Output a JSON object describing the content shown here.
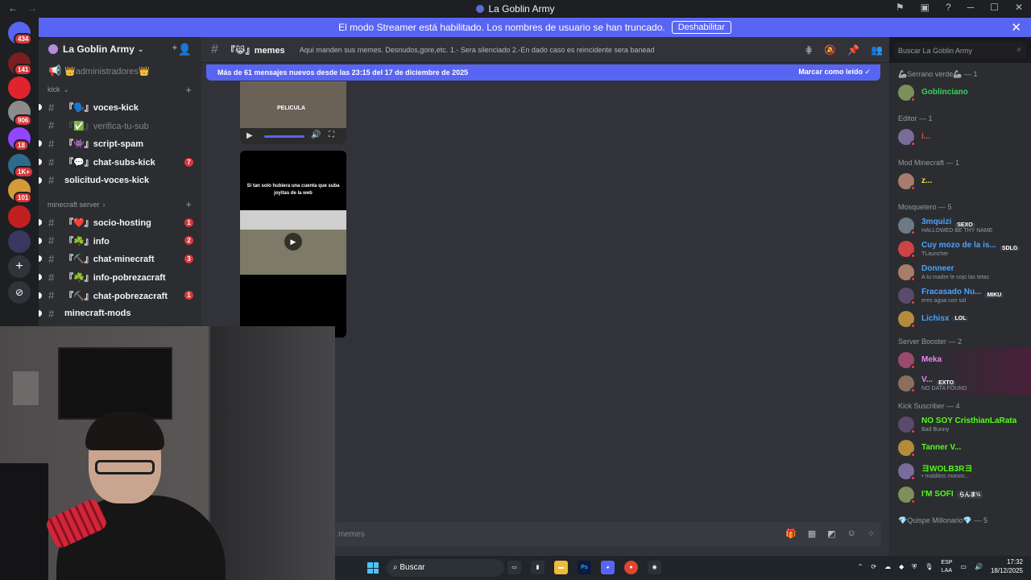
{
  "window": {
    "title": "La Goblin Army"
  },
  "banner": {
    "text": "El modo Streamer está habilitado. Los nombres de usuario se han truncado.",
    "button": "Deshabilitar"
  },
  "guilds": [
    {
      "badge": "434"
    },
    {
      "badge": "141"
    },
    {
      "badge": ""
    },
    {
      "badge": "906"
    },
    {
      "badge": "18"
    },
    {
      "badge": "1K+"
    },
    {
      "badge": "101"
    },
    {
      "badge": ""
    },
    {
      "badge": ""
    }
  ],
  "server": {
    "name": "La Goblin Army"
  },
  "channels_top": {
    "admin": "👑administradores👑"
  },
  "categories": {
    "kick": "kick",
    "minecraft": "minecraft server"
  },
  "channels": [
    {
      "name": "『🗣️』voces-kick",
      "badge": "",
      "unread": true,
      "muted": false
    },
    {
      "name": "『✅』verifica-tu-sub",
      "badge": "",
      "unread": false,
      "muted": true
    },
    {
      "name": "『👾』script-spam",
      "badge": "",
      "unread": true,
      "muted": false
    },
    {
      "name": "『💬』chat-subs-kick",
      "badge": "7",
      "unread": true,
      "muted": false
    },
    {
      "name": "solicitud-voces-kick",
      "badge": "",
      "unread": true,
      "muted": false
    },
    {
      "name": "『❤️』socio-hosting",
      "badge": "1",
      "unread": true,
      "muted": false
    },
    {
      "name": "『☘️』info",
      "badge": "2",
      "unread": true,
      "muted": false
    },
    {
      "name": "『⛏️』chat-minecraft",
      "badge": "3",
      "unread": true,
      "muted": false
    },
    {
      "name": "『☘️』info-pobrezacraft",
      "badge": "",
      "unread": true,
      "muted": false
    },
    {
      "name": "『⛏️』chat-pobrezacraft",
      "badge": "1",
      "unread": true,
      "muted": false
    },
    {
      "name": "minecraft-mods",
      "badge": "",
      "unread": true,
      "muted": false
    }
  ],
  "chat": {
    "channel": "『😹』memes",
    "topic": "Aqui manden sus memes. Desnudos,gore,etc. 1.- Sera silenciado 2.-En dado caso es reincidente sera baneado",
    "new_messages": "Más de 61 mensajes nuevos desde las 23:15 del 17 de diciembre de 2025",
    "mark_read": "Marcar como leído",
    "media1_label": "PELICULA",
    "media2_caption": "Si tan solo hubiera una cuenta que suba joyitas de la web",
    "composer_placeholder": "memes"
  },
  "search": {
    "placeholder": "Buscar La Goblin Army"
  },
  "members": {
    "roles": [
      {
        "label": "🦾Serrano verde🦾 — 1"
      },
      {
        "label": "Editor — 1"
      },
      {
        "label": "Mod Minecraft — 1"
      },
      {
        "label": "Mosquetero — 5"
      },
      {
        "label": "Server Booster — 2"
      },
      {
        "label": "Kick Suscriber — 4"
      },
      {
        "label": "💎Quispe Millonario💎 — 5"
      }
    ],
    "serrano": [
      {
        "name": "Goblinciano",
        "color": "#3ad25c",
        "tag": "",
        "sub": ""
      }
    ],
    "editor": [
      {
        "name": "i...",
        "color": "#e8505b",
        "tag": "",
        "sub": ""
      }
    ],
    "mod": [
      {
        "name": "z...",
        "color": "#f0e04a",
        "tag": "",
        "sub": ""
      }
    ],
    "mosquetero": [
      {
        "name": "3mquizi",
        "color": "#4aa3ff",
        "tag": "SEXO",
        "sub": "HALLOWED BE THY NAME"
      },
      {
        "name": "Cuy mozo de la is...",
        "color": "#4aa3ff",
        "tag": "SDLG",
        "sub": "TLauncher"
      },
      {
        "name": "Donneer",
        "color": "#4aa3ff",
        "tag": "",
        "sub": "A tu madre le cojo las tetas"
      },
      {
        "name": "Fracasado Nu...",
        "color": "#4aa3ff",
        "tag": "MIKU",
        "sub": "eres agua con sal"
      },
      {
        "name": "Lichisx",
        "color": "#4aa3ff",
        "tag": "LOL",
        "sub": ""
      }
    ],
    "boosters": [
      {
        "name": "Meka",
        "color": "#f47fff",
        "tag": "",
        "sub": ""
      },
      {
        "name": "V...",
        "color": "#f47fff",
        "tag": "EXTO",
        "sub": "NO DATA FOUND"
      }
    ],
    "kick": [
      {
        "name": "NO SOY CristhianLaRata",
        "color": "#53fc18",
        "tag": "",
        "sub": "Bad Bunny"
      },
      {
        "name": "Tanner V...",
        "color": "#53fc18",
        "tag": "",
        "sub": ""
      },
      {
        "name": "ヨWOLB3Rヨ",
        "color": "#53fc18",
        "tag": "",
        "sub": "• malditos monos..."
      },
      {
        "name": "I'M SOFI",
        "color": "#53fc18",
        "tag": "らんま½",
        "sub": ""
      }
    ]
  },
  "taskbar": {
    "search": "Buscar",
    "lang": "ESP",
    "lang2": "LAA",
    "time": "17:32",
    "date": "18/12/2025",
    "apps": [
      "",
      "",
      "",
      "Ps",
      "",
      "",
      ""
    ]
  },
  "colors": {
    "accent": "#5865f2",
    "danger": "#da373c"
  }
}
